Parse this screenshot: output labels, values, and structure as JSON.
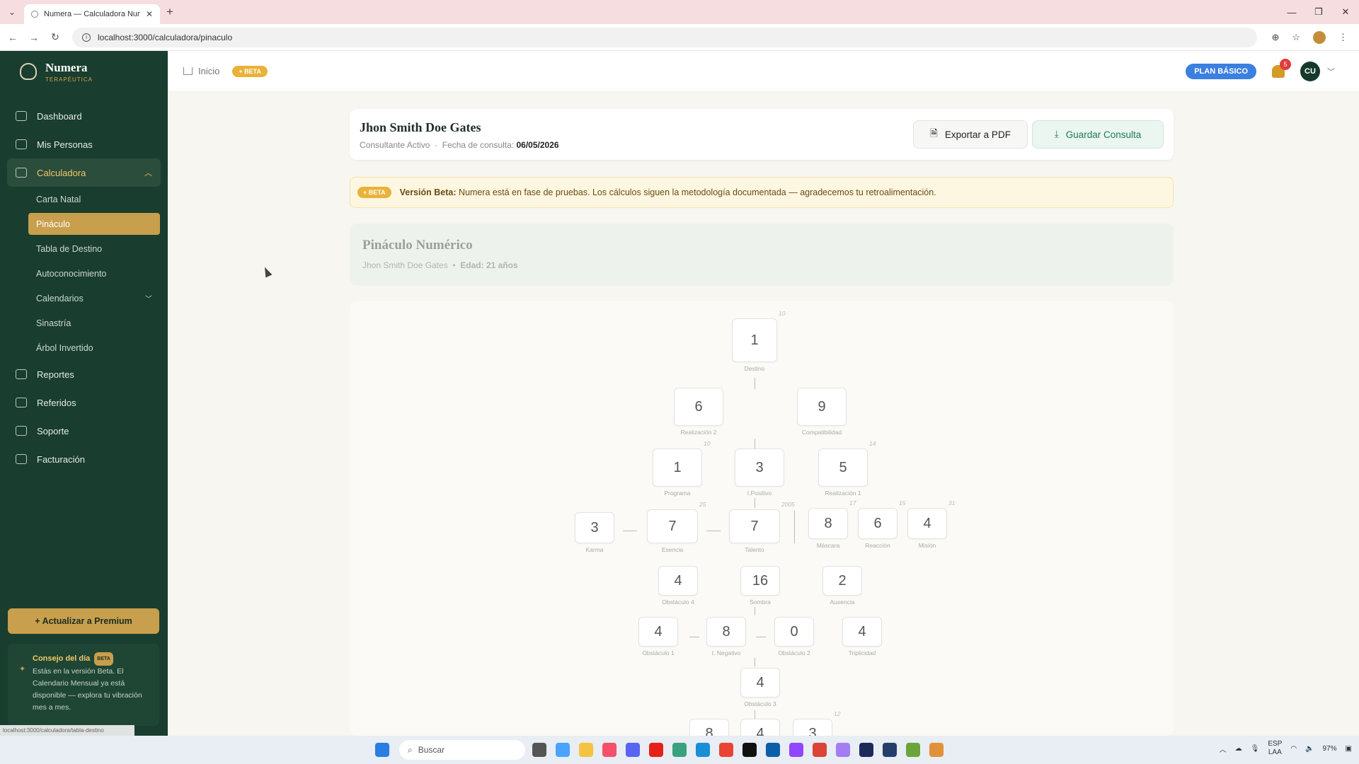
{
  "browser": {
    "tab_title": "Numera — Calculadora Numer",
    "url": "localhost:3000/calculadora/pinaculo",
    "status_url": "localhost:3000/calculadora/tabla-destino"
  },
  "brand": {
    "name": "Numera",
    "sub": "TERAPÉUTICA"
  },
  "sidebar": {
    "items": [
      {
        "label": "Dashboard"
      },
      {
        "label": "Mis Personas"
      },
      {
        "label": "Calculadora"
      },
      {
        "label": "Reportes"
      },
      {
        "label": "Referidos"
      },
      {
        "label": "Soporte"
      },
      {
        "label": "Facturación"
      }
    ],
    "calc_sub": [
      {
        "label": "Carta Natal"
      },
      {
        "label": "Pináculo"
      },
      {
        "label": "Tabla de Destino"
      },
      {
        "label": "Autoconocimiento"
      },
      {
        "label": "Calendarios"
      },
      {
        "label": "Sinastría"
      },
      {
        "label": "Árbol Invertido"
      }
    ],
    "premium_label": "+ Actualizar a Premium",
    "tip": {
      "title": "Consejo del día",
      "badge": "BETA",
      "text": "Estás en la versión Beta. El Calendario Mensual ya está disponible — explora tu vibración mes a mes."
    }
  },
  "topbar": {
    "crumb": "Inicio",
    "beta": "+ BETA",
    "plan": "PLAN BÁSICO",
    "notif_count": "5",
    "avatar": "CU"
  },
  "person": {
    "name": "Jhon Smith Doe Gates",
    "status": "Consultante Activo",
    "date_label": "Fecha de consulta:",
    "date": "06/05/2026",
    "export_label": "Exportar a PDF",
    "save_label": "Guardar Consulta"
  },
  "banner": {
    "badge": "+ BETA",
    "strong": "Versión Beta:",
    "text": "Numera está en fase de pruebas. Los cálculos siguen la metodología documentada — agradecemos tu retroalimentación."
  },
  "pinaculo": {
    "title": "Pináculo Numérico",
    "person": "Jhon Smith Doe Gates",
    "age": "Edad: 21 años",
    "nodes": [
      {
        "id": "destino",
        "value": "1",
        "label": "Destino",
        "index": "10"
      },
      {
        "id": "realizacion2",
        "value": "6",
        "label": "Realización 2",
        "index": ""
      },
      {
        "id": "compatibilidad",
        "value": "9",
        "label": "Compatibilidad",
        "index": ""
      },
      {
        "id": "programa",
        "value": "1",
        "label": "Programa",
        "index": "10"
      },
      {
        "id": "ipositivo",
        "value": "3",
        "label": "I.Positivo",
        "index": ""
      },
      {
        "id": "realizacion1",
        "value": "5",
        "label": "Realización 1",
        "index": "14"
      },
      {
        "id": "karma",
        "value": "3",
        "label": "Karma",
        "index": ""
      },
      {
        "id": "esencia",
        "value": "7",
        "label": "Esencia",
        "index": "25"
      },
      {
        "id": "talento",
        "value": "7",
        "label": "Talento",
        "index": "2005"
      },
      {
        "id": "mascara",
        "value": "8",
        "label": "Máscara",
        "index": "17"
      },
      {
        "id": "reaccion",
        "value": "6",
        "label": "Reacción",
        "index": "15"
      },
      {
        "id": "mision",
        "value": "4",
        "label": "Misión",
        "index": "31"
      },
      {
        "id": "obstaculo4",
        "value": "4",
        "label": "Obstáculo 4",
        "index": ""
      },
      {
        "id": "sombra",
        "value": "16",
        "label": "Sombra",
        "index": ""
      },
      {
        "id": "ausencia",
        "value": "2",
        "label": "Ausencia",
        "index": ""
      },
      {
        "id": "obstaculo1",
        "value": "4",
        "label": "Obstáculo 1",
        "index": ""
      },
      {
        "id": "inegativo",
        "value": "8",
        "label": "I. Negativo",
        "index": ""
      },
      {
        "id": "obstaculo2",
        "value": "0",
        "label": "Obstáculo 2",
        "index": ""
      },
      {
        "id": "triplicidad",
        "value": "4",
        "label": "Triplicidad",
        "index": ""
      },
      {
        "id": "obstaculo3",
        "value": "4",
        "label": "Obstáculo 3",
        "index": ""
      },
      {
        "id": "b1",
        "value": "8",
        "label": "",
        "index": ""
      },
      {
        "id": "b2",
        "value": "4",
        "label": "",
        "index": ""
      },
      {
        "id": "b3",
        "value": "3",
        "label": "",
        "index": "12"
      }
    ]
  },
  "taskbar": {
    "search": "Buscar",
    "lang": "ESP",
    "lang2": "LAA",
    "battery": "97%"
  },
  "colors": {
    "sidebar": "#193d2e",
    "accent": "#c89f4c",
    "plan": "#3b7fe0"
  }
}
